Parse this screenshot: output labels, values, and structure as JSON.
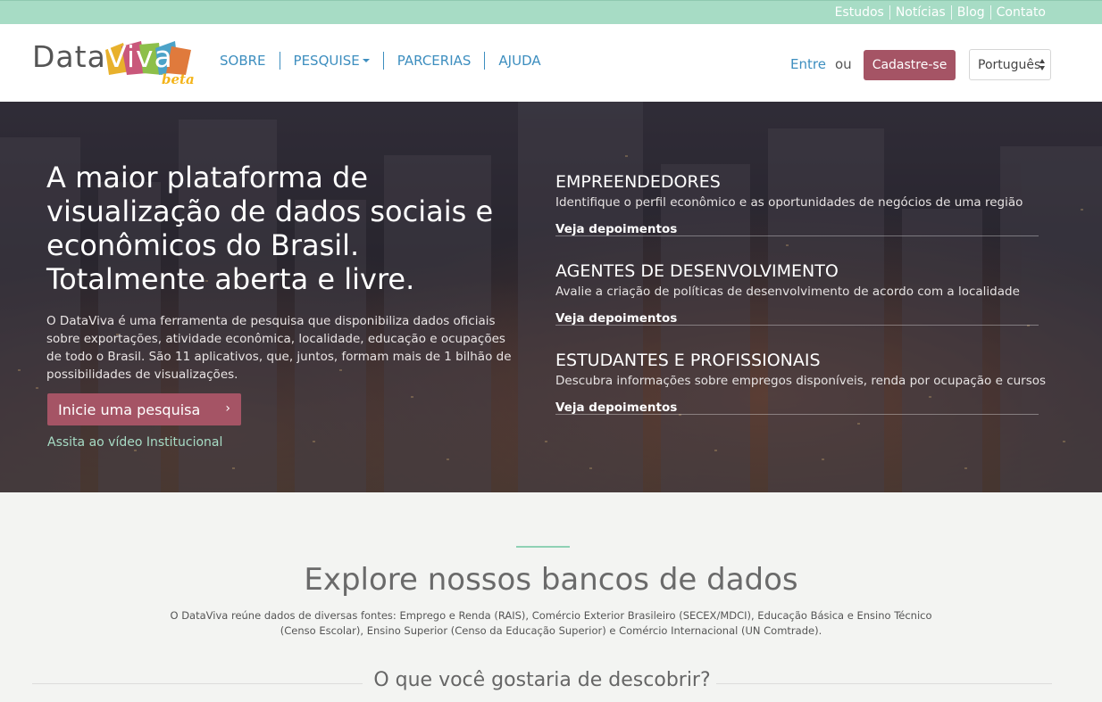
{
  "topbar": {
    "links": [
      "Estudos",
      "Notícias",
      "Blog",
      "Contato"
    ]
  },
  "header": {
    "logo_data": "Data",
    "logo_viva": "Viva",
    "logo_beta": "beta",
    "nav": [
      "SOBRE",
      "PESQUISE",
      "PARCERIAS",
      "AJUDA"
    ],
    "login": "Entre",
    "or": "ou",
    "signup": "Cadastre-se",
    "language": "Português"
  },
  "hero": {
    "title": "A maior plataforma de visualização de dados sociais e econômicos do Brasil. Totalmente aberta e livre.",
    "description": "O DataViva é uma ferramenta de pesquisa que disponibiliza dados oficiais sobre exportações, atividade econômica, localidade, educação e ocupações de todo o Brasil. São 11 aplicativos, que, juntos, formam mais de 1 bilhão de possibilidades de visualizações.",
    "cta": "Inicie uma pesquisa",
    "cta_icon": "chevron-right-icon",
    "video_link": "Assita ao vídeo Institucional",
    "audiences": [
      {
        "title": "EMPREENDEDORES",
        "subtitle": "Identifique o perfil econômico e as oportunidades de negócios de uma região",
        "link": "Veja depoimentos"
      },
      {
        "title": "AGENTES DE DESENVOLVIMENTO",
        "subtitle": "Avalie a criação de políticas de desenvolvimento de acordo com a localidade",
        "link": "Veja depoimentos"
      },
      {
        "title": "ESTUDANTES E PROFISSIONAIS",
        "subtitle": "Descubra informações sobre empregos disponíveis, renda por ocupação e cursos",
        "link": "Veja depoimentos"
      }
    ]
  },
  "explore": {
    "title": "Explore nossos bancos de dados",
    "description": "O DataViva reúne dados de diversas fontes: Emprego e Renda (RAIS), Comércio Exterior Brasileiro (SECEX/MDCI), Educação Básica e Ensino Técnico (Censo Escolar), Ensino Superior (Censo da Educação Superior) e Comércio Internacional (UN Comtrade).",
    "discover": "O que você gostaria de descobrir?"
  },
  "colors": {
    "topbar": "#a7dcc5",
    "link_blue": "#3d8ebf",
    "accent_rose": "#a55465",
    "beta_yellow": "#f4b41a",
    "section_bg": "#f3f4f2"
  }
}
